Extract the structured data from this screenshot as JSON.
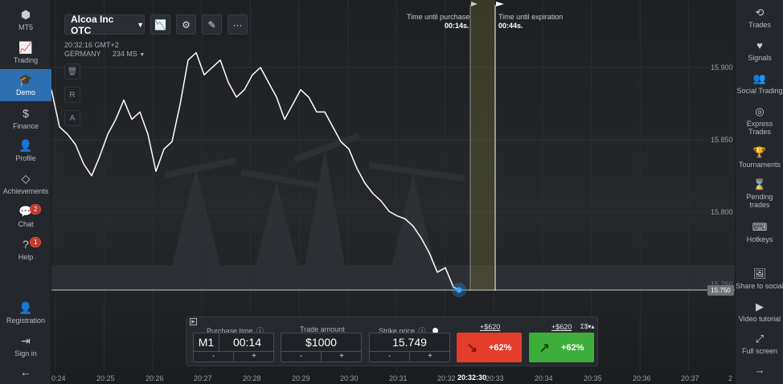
{
  "left_nav": [
    {
      "label": "MT5",
      "icon": "gem-stack-icon",
      "glyph": "⬢"
    },
    {
      "label": "Trading",
      "icon": "chart-line-icon",
      "glyph": "📈"
    },
    {
      "label": "Demo",
      "icon": "graduation-cap-icon",
      "glyph": "🎓"
    },
    {
      "label": "Finance",
      "icon": "dollar-icon",
      "glyph": "$"
    },
    {
      "label": "Profile",
      "icon": "user-icon",
      "glyph": "👤"
    },
    {
      "label": "Achievements",
      "icon": "diamond-icon",
      "glyph": "◇"
    },
    {
      "label": "Chat",
      "icon": "chat-icon",
      "glyph": "💬",
      "badge": "2"
    },
    {
      "label": "Help",
      "icon": "help-icon",
      "glyph": "?",
      "badge": "1"
    },
    {
      "label": "Registration",
      "icon": "user-plus-icon",
      "glyph": "👤"
    },
    {
      "label": "Sign in",
      "icon": "sign-in-icon",
      "glyph": "⇥"
    }
  ],
  "right_nav": [
    {
      "label": "Trades",
      "icon": "history-icon",
      "glyph": "⟲"
    },
    {
      "label": "Signals",
      "icon": "heartbeat-icon",
      "glyph": "♥"
    },
    {
      "label": "Social Trading",
      "icon": "users-icon",
      "glyph": "👥"
    },
    {
      "label": "Express Trades",
      "icon": "target-icon",
      "glyph": "◎"
    },
    {
      "label": "Tournaments",
      "icon": "trophy-icon",
      "glyph": "🏆"
    },
    {
      "label": "Pending trades",
      "icon": "hourglass-icon",
      "glyph": "⌛"
    },
    {
      "label": "Hotkeys",
      "icon": "keyboard-icon",
      "glyph": "⌨"
    },
    {
      "label": "Share to social",
      "icon": "image-icon",
      "glyph": "🖼"
    },
    {
      "label": "Video tutorial",
      "icon": "play-icon",
      "glyph": "▶"
    },
    {
      "label": "Full screen",
      "icon": "expand-icon",
      "glyph": "⤢"
    }
  ],
  "asset": {
    "name": "Alcoa Inc OTC"
  },
  "toolbar": {
    "indicators_glyph": "📉",
    "settings_glyph": "⚙",
    "draw_glyph": "✎",
    "more_glyph": "···"
  },
  "clock": {
    "time": "20:32:16 GMT+2",
    "region": "GERMANY",
    "latency": "234 MS"
  },
  "side_tools": {
    "t1": "🗑",
    "t2": "R",
    "t3": "A"
  },
  "timers": {
    "purchase_label": "Time until purchase",
    "purchase_value": "00:14s.",
    "expiration_label": "Time until expiration",
    "expiration_value": "00:44s."
  },
  "price_axis": [
    "15.900",
    "15.850",
    "15.800",
    "15.750"
  ],
  "current_price": "15.750",
  "time_axis": [
    "0:24",
    "20:25",
    "20:26",
    "20:27",
    "20:28",
    "20:29",
    "20:30",
    "20:31",
    "20:32",
    "20:33",
    "20:34",
    "20:35",
    "20:36",
    "20:37",
    "2"
  ],
  "current_time": "20:32:30",
  "trade": {
    "purchase_time_label": "Purchase time",
    "timeframe": "M1",
    "purchase_time": "00:14",
    "amount_label": "Trade amount",
    "amount": "$1000",
    "strike_label": "Strike price",
    "strike": "15.749",
    "minus": "-",
    "plus": "+",
    "payout_down": "+$620",
    "payout_up": "+$620",
    "down_percent": "+62%",
    "up_percent": "+62%",
    "currency_toggle": "Σ$▾▴"
  },
  "colors": {
    "down": "#e53d2b",
    "up": "#3eae3a",
    "active_nav": "#2d6fb1"
  },
  "chart_data": {
    "type": "line",
    "y_range": [
      15.728,
      15.93
    ],
    "x_range": [
      "20:24",
      "20:38"
    ],
    "x": [
      0,
      10,
      20,
      30,
      40,
      50,
      60,
      70,
      80,
      90,
      100,
      110,
      120,
      130,
      140,
      150,
      160,
      170,
      180,
      190,
      200,
      210,
      220,
      230,
      240,
      250,
      260,
      270,
      280,
      290,
      300,
      310,
      320,
      330,
      340,
      350,
      360,
      370,
      380,
      390,
      400,
      410,
      420,
      430,
      440,
      450,
      460,
      470,
      480,
      490,
      500,
      507
    ],
    "y": [
      15.885,
      15.86,
      15.855,
      15.848,
      15.835,
      15.827,
      15.84,
      15.855,
      15.865,
      15.878,
      15.865,
      15.87,
      15.855,
      15.83,
      15.845,
      15.85,
      15.875,
      15.905,
      15.91,
      15.895,
      15.9,
      15.905,
      15.89,
      15.88,
      15.885,
      15.895,
      15.9,
      15.89,
      15.88,
      15.865,
      15.875,
      15.885,
      15.88,
      15.87,
      15.87,
      15.86,
      15.85,
      15.845,
      15.832,
      15.822,
      15.815,
      15.81,
      15.803,
      15.8,
      15.798,
      15.793,
      15.785,
      15.775,
      15.762,
      15.765,
      15.752,
      15.75
    ]
  }
}
